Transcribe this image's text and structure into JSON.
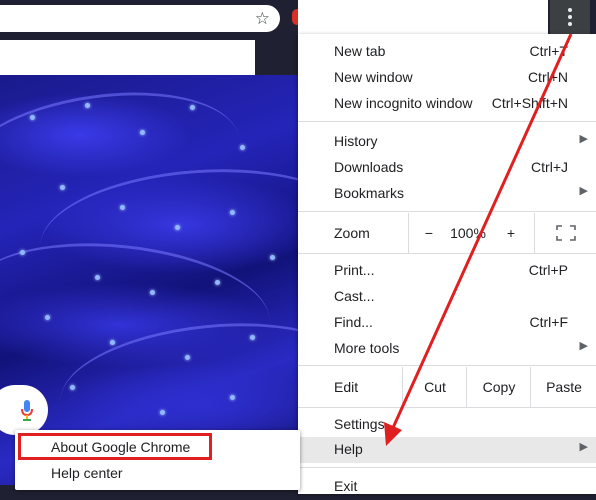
{
  "menu": {
    "new_tab": {
      "label": "New tab",
      "shortcut": "Ctrl+T"
    },
    "new_window": {
      "label": "New window",
      "shortcut": "Ctrl+N"
    },
    "new_incognito": {
      "label": "New incognito window",
      "shortcut": "Ctrl+Shift+N"
    },
    "history": {
      "label": "History"
    },
    "downloads": {
      "label": "Downloads",
      "shortcut": "Ctrl+J"
    },
    "bookmarks": {
      "label": "Bookmarks"
    },
    "zoom": {
      "label": "Zoom",
      "minus": "−",
      "level": "100%",
      "plus": "+"
    },
    "print": {
      "label": "Print...",
      "shortcut": "Ctrl+P"
    },
    "cast": {
      "label": "Cast..."
    },
    "find": {
      "label": "Find...",
      "shortcut": "Ctrl+F"
    },
    "more_tools": {
      "label": "More tools"
    },
    "edit": {
      "label": "Edit",
      "cut": "Cut",
      "copy": "Copy",
      "paste": "Paste"
    },
    "settings": {
      "label": "Settings"
    },
    "help": {
      "label": "Help"
    },
    "exit": {
      "label": "Exit"
    }
  },
  "help_submenu": {
    "about": "About Google Chrome",
    "help_center": "Help center"
  },
  "colors": {
    "highlight_box": "#e02020",
    "arrow": "#e02020",
    "menu_hover": "#e8e8e8"
  }
}
